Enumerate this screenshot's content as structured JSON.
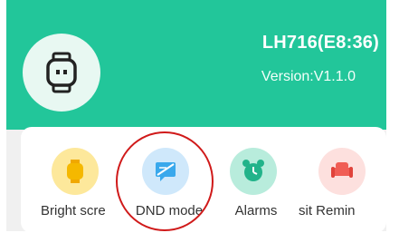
{
  "header": {
    "device_name": "LH716(E8:36)",
    "version": "Version:V1.1.0",
    "background_color": "#22c69a",
    "device_icon": "smartwatch-icon"
  },
  "features": [
    {
      "label": "Bright scre",
      "icon": "bright-screen-icon",
      "color": "#fde89b"
    },
    {
      "label": "DND mode",
      "icon": "dnd-message-icon",
      "color": "#cfe8fb"
    },
    {
      "label": "Alarms",
      "icon": "alarm-clock-icon",
      "color": "#b8ecdc"
    },
    {
      "label": "sit Remin",
      "icon": "sedentary-reminder-icon",
      "color": "#fde0de"
    }
  ],
  "annotation": {
    "shape": "red-circle",
    "target": "DND mode",
    "color": "#d01a1a"
  }
}
